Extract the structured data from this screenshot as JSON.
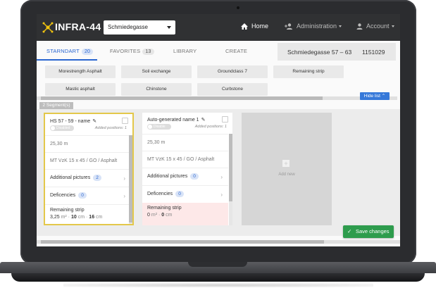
{
  "app": {
    "brand": "INFRA-44"
  },
  "header": {
    "site_select": "Schmiedegasse",
    "home": "Home",
    "administration": "Administration",
    "account": "Account"
  },
  "tabs": [
    {
      "label": "STARNDART",
      "count": "20"
    },
    {
      "label": "FAVORITES",
      "count": "13"
    },
    {
      "label": "LIBRARY"
    },
    {
      "label": "CREATE"
    }
  ],
  "site_info": {
    "name": "Schmiedegasse 57 – 63",
    "code": "1151029"
  },
  "library": {
    "row1": [
      "Morestrength Asphalt",
      "Soil exchange",
      "Groundclass 7",
      "Remaining strip"
    ],
    "row2": [
      "Mastic asphalt",
      "Chinstone",
      "Curbstone"
    ],
    "hide_list": "Hide list"
  },
  "segments": {
    "label": "2 Segment(s)",
    "cards": [
      {
        "title": "HS 57 - 59 - name",
        "toggle": "Disabled",
        "added": "Added positions: 1",
        "length": "25,30 m",
        "material": "MT VzK 15 x 45 / GO / Asphalt",
        "pictures_label": "Additional pictures",
        "pictures_count": "2",
        "deficiencies_label": "Deficencies",
        "deficiencies_count": "0",
        "remaining_label": "Remaining strip",
        "rs_area": "3,25",
        "rs_area_unit": "m² ·",
        "rs_w": "10",
        "rs_w_unit": "cm ·",
        "rs_d": "16",
        "rs_d_unit": "cm"
      },
      {
        "title": "Auto-generated name 1",
        "toggle": "Disable",
        "added": "Added positions: 1",
        "length": "25,30 m",
        "material": "MT VzK 15 x 45 / GO / Asphalt",
        "pictures_label": "Additional pictures",
        "pictures_count": "0",
        "deficiencies_label": "Deficencies",
        "deficiencies_count": "0",
        "remaining_label": "Remaining strip",
        "rs_area": "0",
        "rs_area_unit": "m² ·",
        "rs_w": "0",
        "rs_w_unit": "cm"
      }
    ],
    "add_new": "Add new"
  },
  "save": "Save changes",
  "colors": {
    "accent": "#2a66d0",
    "selected_border": "#e3c84a",
    "save": "#2e9c4d",
    "header": "#303133"
  }
}
